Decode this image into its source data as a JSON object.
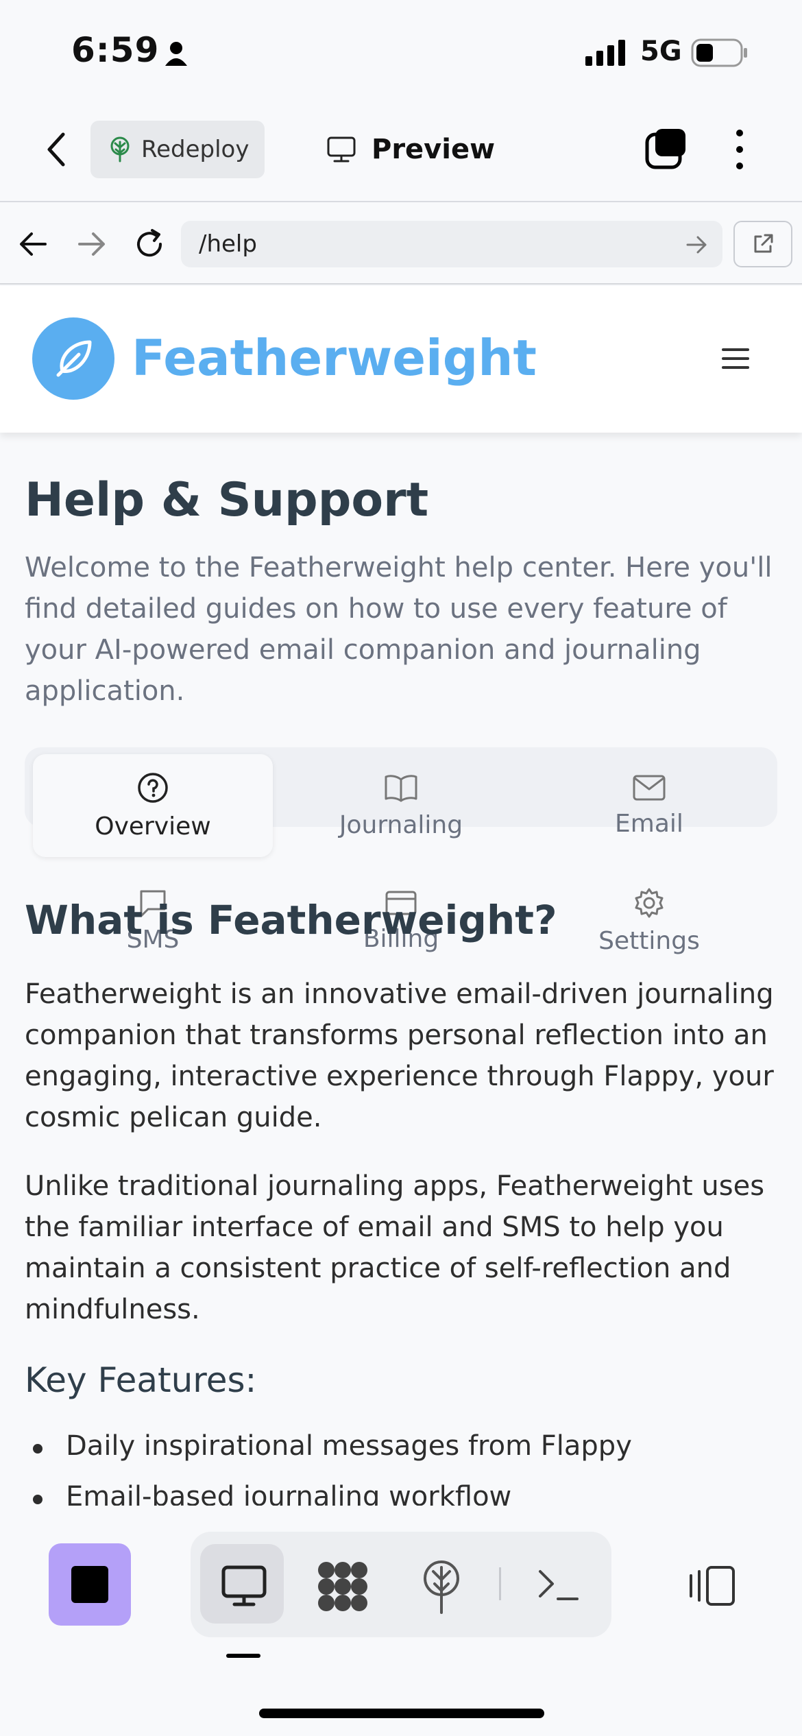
{
  "status": {
    "time": "6:59",
    "network": "5G"
  },
  "topbar": {
    "redeploy_label": "Redeploy",
    "preview_label": "Preview"
  },
  "browser": {
    "url": "/help"
  },
  "site": {
    "brand": "Featherweight"
  },
  "page": {
    "title": "Help & Support",
    "intro": "Welcome to the Featherweight help center. Here you'll find detailed guides on how to use every feature of your AI-powered email companion and journaling application.",
    "tabs": [
      {
        "label": "Overview",
        "icon": "help-circle-icon"
      },
      {
        "label": "Journaling",
        "icon": "book-open-icon"
      },
      {
        "label": "Email",
        "icon": "mail-icon"
      },
      {
        "label": "SMS",
        "icon": "message-square-icon"
      },
      {
        "label": "Billing",
        "icon": "credit-card-icon"
      },
      {
        "label": "Settings",
        "icon": "settings-gear-icon"
      }
    ],
    "section_title": "What is Featherweight?",
    "para1": "Featherweight is an innovative email-driven journaling companion that transforms personal reflection into an engaging, interactive experience through Flappy, your cosmic pelican guide.",
    "para2": "Unlike traditional journaling apps, Featherweight uses the familiar interface of email and SMS to help you maintain a consistent practice of self-reflection and mindfulness.",
    "features_title": "Key Features:",
    "features": [
      "Daily inspirational messages from Flappy",
      "Email-based journaling workflow"
    ]
  }
}
